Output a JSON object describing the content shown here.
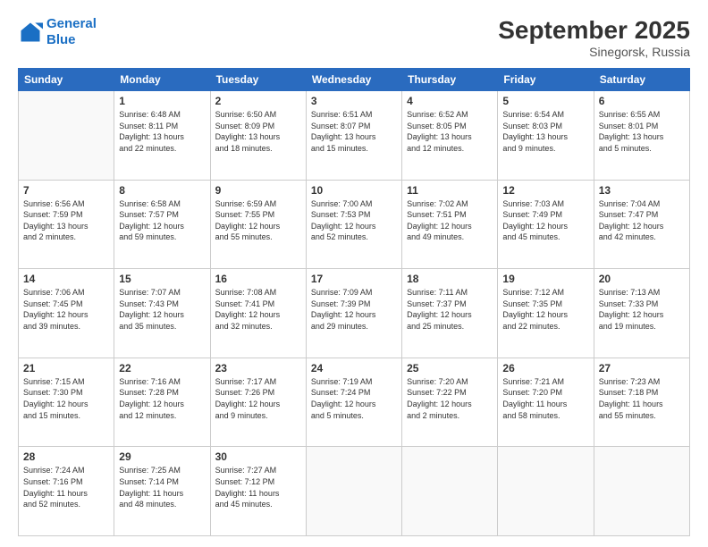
{
  "header": {
    "logo_line1": "General",
    "logo_line2": "Blue",
    "month": "September 2025",
    "location": "Sinegorsk, Russia"
  },
  "weekdays": [
    "Sunday",
    "Monday",
    "Tuesday",
    "Wednesday",
    "Thursday",
    "Friday",
    "Saturday"
  ],
  "weeks": [
    [
      {
        "day": "",
        "info": ""
      },
      {
        "day": "1",
        "info": "Sunrise: 6:48 AM\nSunset: 8:11 PM\nDaylight: 13 hours\nand 22 minutes."
      },
      {
        "day": "2",
        "info": "Sunrise: 6:50 AM\nSunset: 8:09 PM\nDaylight: 13 hours\nand 18 minutes."
      },
      {
        "day": "3",
        "info": "Sunrise: 6:51 AM\nSunset: 8:07 PM\nDaylight: 13 hours\nand 15 minutes."
      },
      {
        "day": "4",
        "info": "Sunrise: 6:52 AM\nSunset: 8:05 PM\nDaylight: 13 hours\nand 12 minutes."
      },
      {
        "day": "5",
        "info": "Sunrise: 6:54 AM\nSunset: 8:03 PM\nDaylight: 13 hours\nand 9 minutes."
      },
      {
        "day": "6",
        "info": "Sunrise: 6:55 AM\nSunset: 8:01 PM\nDaylight: 13 hours\nand 5 minutes."
      }
    ],
    [
      {
        "day": "7",
        "info": "Sunrise: 6:56 AM\nSunset: 7:59 PM\nDaylight: 13 hours\nand 2 minutes."
      },
      {
        "day": "8",
        "info": "Sunrise: 6:58 AM\nSunset: 7:57 PM\nDaylight: 12 hours\nand 59 minutes."
      },
      {
        "day": "9",
        "info": "Sunrise: 6:59 AM\nSunset: 7:55 PM\nDaylight: 12 hours\nand 55 minutes."
      },
      {
        "day": "10",
        "info": "Sunrise: 7:00 AM\nSunset: 7:53 PM\nDaylight: 12 hours\nand 52 minutes."
      },
      {
        "day": "11",
        "info": "Sunrise: 7:02 AM\nSunset: 7:51 PM\nDaylight: 12 hours\nand 49 minutes."
      },
      {
        "day": "12",
        "info": "Sunrise: 7:03 AM\nSunset: 7:49 PM\nDaylight: 12 hours\nand 45 minutes."
      },
      {
        "day": "13",
        "info": "Sunrise: 7:04 AM\nSunset: 7:47 PM\nDaylight: 12 hours\nand 42 minutes."
      }
    ],
    [
      {
        "day": "14",
        "info": "Sunrise: 7:06 AM\nSunset: 7:45 PM\nDaylight: 12 hours\nand 39 minutes."
      },
      {
        "day": "15",
        "info": "Sunrise: 7:07 AM\nSunset: 7:43 PM\nDaylight: 12 hours\nand 35 minutes."
      },
      {
        "day": "16",
        "info": "Sunrise: 7:08 AM\nSunset: 7:41 PM\nDaylight: 12 hours\nand 32 minutes."
      },
      {
        "day": "17",
        "info": "Sunrise: 7:09 AM\nSunset: 7:39 PM\nDaylight: 12 hours\nand 29 minutes."
      },
      {
        "day": "18",
        "info": "Sunrise: 7:11 AM\nSunset: 7:37 PM\nDaylight: 12 hours\nand 25 minutes."
      },
      {
        "day": "19",
        "info": "Sunrise: 7:12 AM\nSunset: 7:35 PM\nDaylight: 12 hours\nand 22 minutes."
      },
      {
        "day": "20",
        "info": "Sunrise: 7:13 AM\nSunset: 7:33 PM\nDaylight: 12 hours\nand 19 minutes."
      }
    ],
    [
      {
        "day": "21",
        "info": "Sunrise: 7:15 AM\nSunset: 7:30 PM\nDaylight: 12 hours\nand 15 minutes."
      },
      {
        "day": "22",
        "info": "Sunrise: 7:16 AM\nSunset: 7:28 PM\nDaylight: 12 hours\nand 12 minutes."
      },
      {
        "day": "23",
        "info": "Sunrise: 7:17 AM\nSunset: 7:26 PM\nDaylight: 12 hours\nand 9 minutes."
      },
      {
        "day": "24",
        "info": "Sunrise: 7:19 AM\nSunset: 7:24 PM\nDaylight: 12 hours\nand 5 minutes."
      },
      {
        "day": "25",
        "info": "Sunrise: 7:20 AM\nSunset: 7:22 PM\nDaylight: 12 hours\nand 2 minutes."
      },
      {
        "day": "26",
        "info": "Sunrise: 7:21 AM\nSunset: 7:20 PM\nDaylight: 11 hours\nand 58 minutes."
      },
      {
        "day": "27",
        "info": "Sunrise: 7:23 AM\nSunset: 7:18 PM\nDaylight: 11 hours\nand 55 minutes."
      }
    ],
    [
      {
        "day": "28",
        "info": "Sunrise: 7:24 AM\nSunset: 7:16 PM\nDaylight: 11 hours\nand 52 minutes."
      },
      {
        "day": "29",
        "info": "Sunrise: 7:25 AM\nSunset: 7:14 PM\nDaylight: 11 hours\nand 48 minutes."
      },
      {
        "day": "30",
        "info": "Sunrise: 7:27 AM\nSunset: 7:12 PM\nDaylight: 11 hours\nand 45 minutes."
      },
      {
        "day": "",
        "info": ""
      },
      {
        "day": "",
        "info": ""
      },
      {
        "day": "",
        "info": ""
      },
      {
        "day": "",
        "info": ""
      }
    ]
  ]
}
